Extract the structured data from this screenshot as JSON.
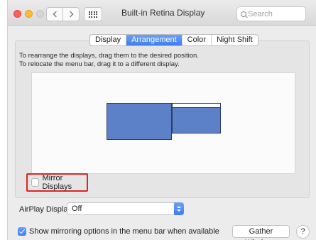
{
  "window": {
    "title": "Built-in Retina Display"
  },
  "search": {
    "placeholder": "Search"
  },
  "tabs": [
    {
      "label": "Display",
      "active": false
    },
    {
      "label": "Arrangement",
      "active": true
    },
    {
      "label": "Color",
      "active": false
    },
    {
      "label": "Night Shift",
      "active": false
    }
  ],
  "instructions": {
    "line1": "To rearrange the displays, drag them to the desired position.",
    "line2": "To relocate the menu bar, drag it to a different display."
  },
  "mirror": {
    "label": "Mirror Displays",
    "checked": false
  },
  "airplay": {
    "label": "AirPlay Display:",
    "value": "Off"
  },
  "show_mirroring": {
    "label": "Show mirroring options in the menu bar when available",
    "checked": true
  },
  "buttons": {
    "gather": "Gather Windows",
    "help": "?"
  },
  "colors": {
    "display_fill": "#5d81c8",
    "accent": "#3d7ef2",
    "highlight_box": "#e02424"
  }
}
